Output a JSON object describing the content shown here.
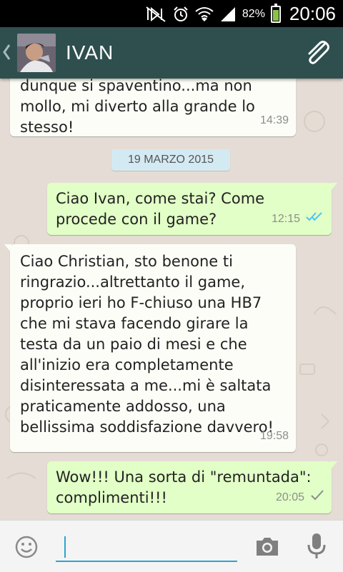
{
  "status_bar": {
    "battery_text": "82%",
    "battery_level": 0.82,
    "time": "20:06",
    "icons": [
      "mute-icon",
      "alarm-icon",
      "wifi-icon",
      "signal-icon",
      "battery-icon"
    ]
  },
  "header": {
    "contact_name": "IVAN",
    "icons": [
      "back-chevron-icon",
      "avatar",
      "paperclip-icon"
    ]
  },
  "messages": [
    {
      "direction": "in",
      "text": "dunque si spaventino...ma non\nmollo, mi diverto alla grande lo\nstesso!",
      "time": "14:39"
    },
    {
      "direction": "out",
      "text": "Ciao Ivan, come stai? Come\nprocede con il game?",
      "time": "12:15",
      "status": "read"
    },
    {
      "direction": "in",
      "text": "Ciao Christian, sto benone ti\nringrazio...altrettanto il game,\nproprio ieri ho F-chiuso una HB7\nche mi stava facendo girare la\ntesta da un paio di mesi e che\nall'inizio era completamente\ndisinteressata a me...mi è saltata\npraticamente addosso, una\nbellissima soddisfazione davvero!",
      "time": "19:58"
    },
    {
      "direction": "out",
      "text": "Wow!!! Una sorta di \"remuntada\":\ncomplimenti!!!",
      "time": "20:05",
      "status": "sent"
    }
  ],
  "date_divider": "19 MARZO 2015",
  "composer": {
    "value": "",
    "icons": [
      "emoji-icon",
      "camera-icon",
      "microphone-icon"
    ]
  },
  "colors": {
    "header_bg": "#2f4f4f",
    "incoming_bubble": "#fdfdf8",
    "outgoing_bubble": "#e2ffc7",
    "read_ticks": "#4fc3f7",
    "input_underline": "#2aa4d0"
  }
}
